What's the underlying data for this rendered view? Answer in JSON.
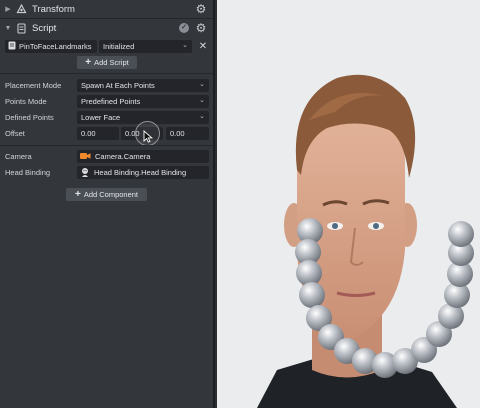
{
  "transform": {
    "title": "Transform",
    "settings_icon": "gear-icon"
  },
  "script": {
    "title": "Script",
    "enabled_icon": "check-icon",
    "script_name": "PinToFaceLandmarks",
    "status": "Initialized",
    "add_script_label": "Add Script"
  },
  "properties": {
    "placement_mode": {
      "label": "Placement Mode",
      "value": "Spawn At Each Points"
    },
    "points_mode": {
      "label": "Points Mode",
      "value": "Predefined Points"
    },
    "defined_points": {
      "label": "Defined Points",
      "value": "Lower Face"
    },
    "offset": {
      "label": "Offset",
      "x": "0.00",
      "y": "0.00",
      "z": "0.00"
    },
    "camera": {
      "label": "Camera",
      "value": "Camera.Camera"
    },
    "head_binding": {
      "label": "Head Binding",
      "value": "Head Binding.Head Binding"
    }
  },
  "add_component_label": "Add Component",
  "colors": {
    "panel": "#33363b",
    "field": "#23252a",
    "button": "#4a4e55",
    "camera_icon": "#f08a2a"
  }
}
